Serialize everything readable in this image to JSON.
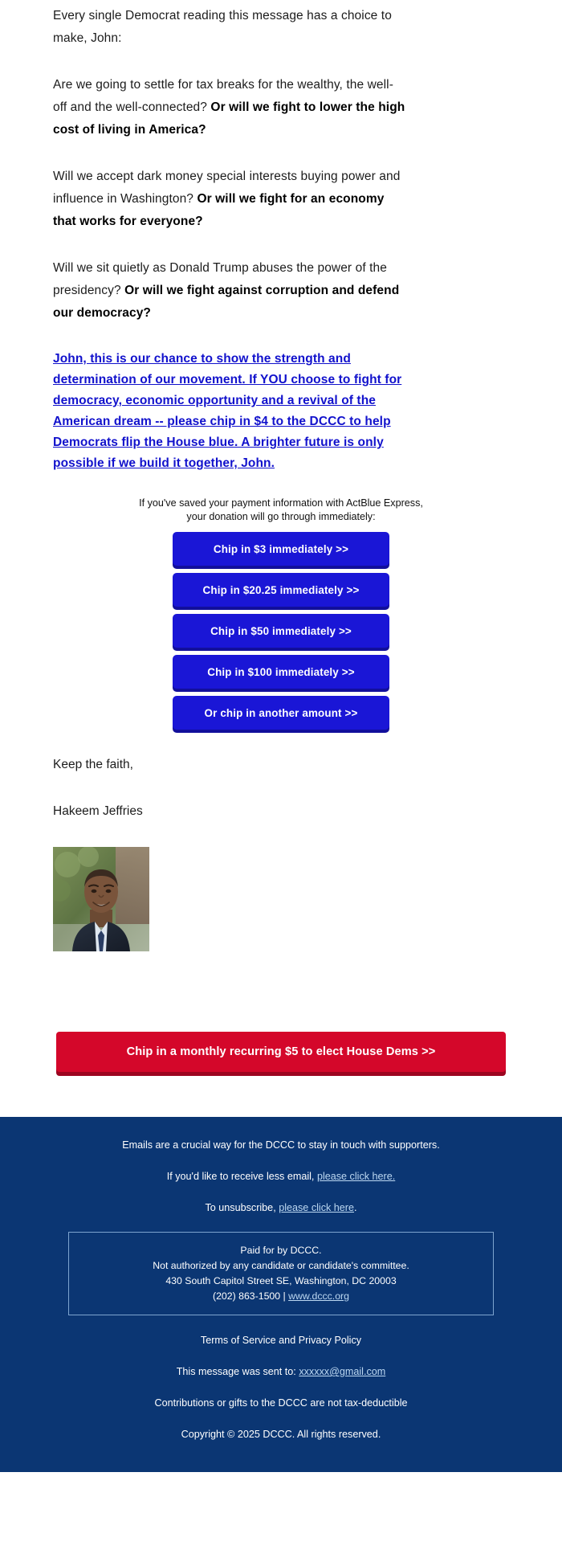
{
  "email": {
    "paragraphs": [
      {
        "id": "p1",
        "segments": [
          {
            "text": "Every single Democrat reading this message has a choice to make, John:",
            "bold": false
          }
        ]
      },
      {
        "id": "p2",
        "segments": [
          {
            "text": "Are we going to settle for tax breaks for the wealthy, the well-off and the well-connected? ",
            "bold": false
          },
          {
            "text": "Or will we fight to lower the high cost of living in America?",
            "bold": true
          }
        ]
      },
      {
        "id": "p3",
        "segments": [
          {
            "text": "Will we accept dark money special interests buying power and influence in Washington? ",
            "bold": false
          },
          {
            "text": "Or will we fight for an economy that works for everyone?",
            "bold": true
          }
        ]
      },
      {
        "id": "p4",
        "segments": [
          {
            "text": "Will we sit quietly as Donald Trump abuses the power of the presidency? ",
            "bold": false
          },
          {
            "text": "Or will we fight against corruption and defend our democracy?",
            "bold": true
          }
        ]
      }
    ],
    "ask_link": "John, this is our chance to show the strength and determination of our movement. If YOU choose to fight for democracy, economic opportunity and a revival of the American dream -- please chip in $4 to the DCCC to help Democrats flip the House blue. A brighter future is only possible if we build it together, John.",
    "actblue_note_line1": "If you've saved your payment information with ActBlue Express,",
    "actblue_note_line2": "your donation will go through immediately:",
    "chip_buttons": [
      {
        "label": "Chip in $3 immediately >>",
        "amount": "$3"
      },
      {
        "label": "Chip in $20.25 immediately >>",
        "amount": "$20.25"
      },
      {
        "label": "Chip in $50 immediately >>",
        "amount": "$50"
      },
      {
        "label": "Chip in $100 immediately >>",
        "amount": "$100"
      },
      {
        "label": "Or chip in another amount >>",
        "amount": "other"
      }
    ],
    "signoff": "Keep the faith,",
    "sender_name": "Hakeem Jeffries",
    "recurring_cta": "Chip in a monthly recurring $5 to elect House Dems >>"
  },
  "footer": {
    "line1": "Emails are a crucial way for the DCCC to stay in touch with supporters.",
    "line2_prefix": "If you'd like to receive less email, ",
    "line2_link": "please click here.",
    "line3_prefix": "To unsubscribe, ",
    "line3_link": "please click here",
    "line3_suffix": ".",
    "address_box": {
      "paid_for": "Paid for by DCCC.",
      "not_authorized": "Not authorized by any candidate or candidate's committee.",
      "street": "430 South Capitol Street SE, Washington, DC 20003",
      "phone": "(202) 863-1500 | ",
      "website": "www.dccc.org"
    },
    "terms": "Terms of Service and Privacy Policy",
    "sent_to_prefix": "This message was sent to: ",
    "sent_to_email": "xxxxxx@gmail.com",
    "tax_note": "Contributions or gifts to the DCCC are not tax-deductible",
    "copyright": "Copyright © 2025 DCCC. All rights reserved."
  },
  "colors": {
    "chip_blue": "#1a16d6",
    "chip_blue_shadow": "#120f9b",
    "cta_red": "#d4072a",
    "cta_red_shadow": "#9c0520",
    "footer_navy": "#0b3673",
    "link_blue": "#1111cc",
    "footer_link": "#bcd8f2"
  }
}
